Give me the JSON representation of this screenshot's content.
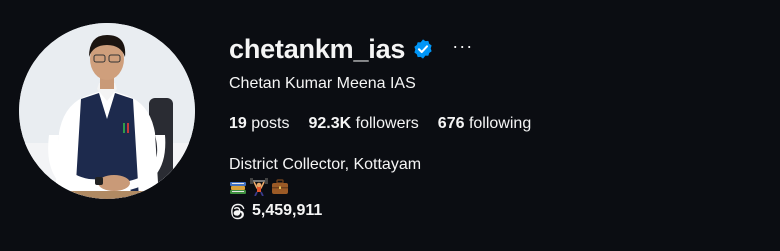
{
  "profile": {
    "username": "chetankm_ias",
    "verified": true,
    "more_label": "···",
    "full_name": "Chetan Kumar Meena IAS",
    "stats": {
      "posts_count": "19",
      "posts_label": "posts",
      "followers_count": "92.3K",
      "followers_label": "followers",
      "following_count": "676",
      "following_label": "following"
    },
    "bio": "District Collector, Kottayam",
    "bio_emojis": [
      "books-emoji",
      "person-lifting-weights-emoji",
      "briefcase-emoji"
    ],
    "threads_count": "5,459,911"
  },
  "colors": {
    "background": "#0b0d12",
    "text": "#f5f5f5",
    "verified_badge": "#0095f6"
  }
}
